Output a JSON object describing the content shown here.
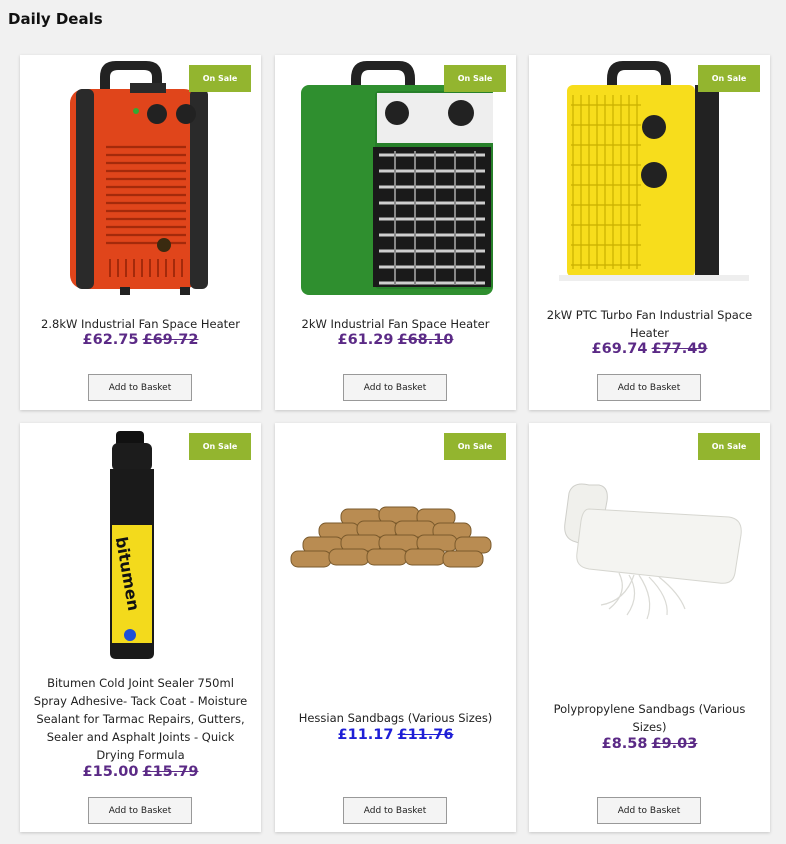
{
  "section": {
    "title": "Daily Deals"
  },
  "products": [
    {
      "name": "2.8kW Industrial Fan Space Heater",
      "price": "£62.75",
      "old_price": "£69.72",
      "badge": "On Sale",
      "button": "Add to Basket",
      "price_color": "#5b2a86",
      "image": "orange-heater"
    },
    {
      "name": "2kW Industrial Fan Space Heater",
      "price": "£61.29",
      "old_price": "£68.10",
      "badge": "On Sale",
      "button": "Add to Basket",
      "price_color": "#5b2a86",
      "image": "green-heater"
    },
    {
      "name": "2kW PTC Turbo Fan Industrial Space Heater",
      "price": "£69.74",
      "old_price": "£77.49",
      "badge": "On Sale",
      "button": "Add to Basket",
      "price_color": "#5b2a86",
      "image": "yellow-heater"
    },
    {
      "name": "Bitumen Cold Joint Sealer 750ml Spray Adhesive- Tack Coat - Moisture Sealant for Tarmac Repairs, Gutters, Sealer and Asphalt Joints - Quick Drying Formula",
      "price": "£15.00",
      "old_price": "£15.79",
      "badge": "On Sale",
      "button": "Add to Basket",
      "price_color": "#5b2a86",
      "image": "bitumen-spray-can"
    },
    {
      "name": "Hessian Sandbags (Various Sizes)",
      "price": "£11.17",
      "old_price": "£11.76",
      "badge": "On Sale",
      "button": "Add to Basket",
      "price_color": "#1f1fd6",
      "image": "hessian-sandbags"
    },
    {
      "name": "Polypropylene Sandbags (Various Sizes)",
      "price": "£8.58",
      "old_price": "£9.03",
      "badge": "On Sale",
      "button": "Add to Basket",
      "price_color": "#5b2a86",
      "image": "polypropylene-sandbag"
    }
  ]
}
